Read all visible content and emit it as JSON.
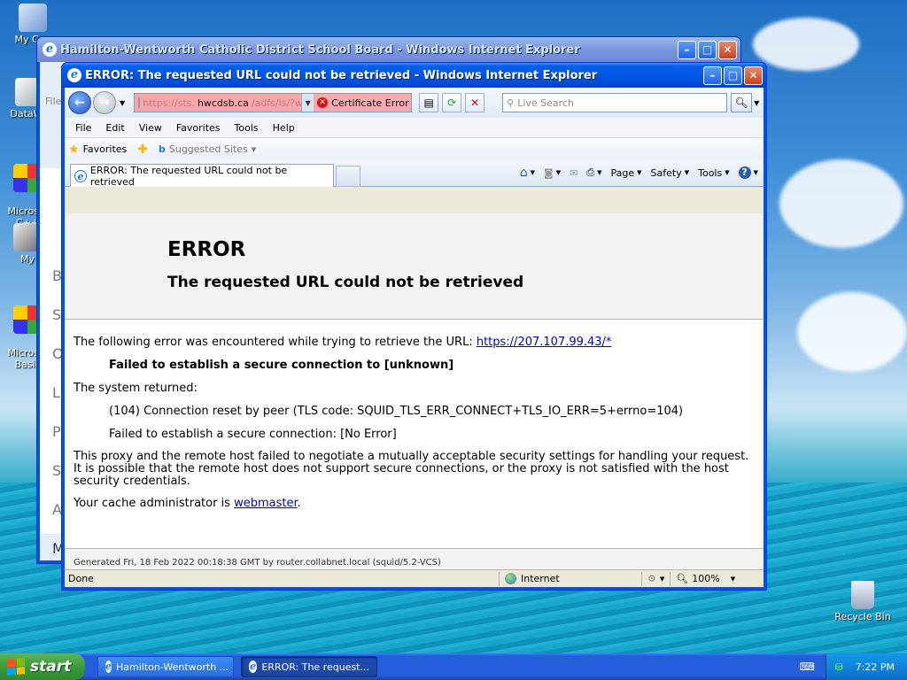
{
  "desktop": {
    "icons": [
      {
        "label": "My Con"
      },
      {
        "label": "DataWa"
      },
      {
        "label": "Microsol\nC++"
      },
      {
        "label": "My"
      },
      {
        "label": "Microsol\nBasic"
      },
      {
        "label": "Recycle Bin"
      }
    ]
  },
  "bg_window": {
    "title": "Hamilton-Wentworth Catholic District School Board - Windows Internet Explorer",
    "side_letters": [
      "B",
      "S",
      "O",
      "L",
      "P",
      "S",
      "A",
      "M"
    ],
    "file_menu": "File"
  },
  "window": {
    "title": "ERROR: The requested URL could not be retrieved - Windows Internet Explorer",
    "address": {
      "prefix": "https://sts.",
      "domain": "hwcdsb.ca",
      "suffix": "/adfs/ls/?wa"
    },
    "cert_error": "Certificate Error",
    "search_placeholder": "Live Search",
    "menu": [
      "File",
      "Edit",
      "View",
      "Favorites",
      "Tools",
      "Help"
    ],
    "favorites_label": "Favorites",
    "suggested_sites": "Suggested Sites",
    "tab_title": "ERROR: The requested URL could not be retrieved",
    "cmd": {
      "page": "Page",
      "safety": "Safety",
      "tools": "Tools"
    },
    "status": {
      "text": "Done",
      "zone": "Internet",
      "zoom": "100%"
    }
  },
  "page": {
    "h1": "ERROR",
    "h2": "The requested URL could not be retrieved",
    "intro": "The following error was encountered while trying to retrieve the URL: ",
    "url": "https://207.107.99.43/*",
    "failed": "Failed to establish a secure connection to [unknown]",
    "system_returned": "The system returned:",
    "reset": "(104) Connection reset by peer (TLS code: SQUID_TLS_ERR_CONNECT+TLS_IO_ERR=5+errno=104)",
    "failed2": "Failed to establish a secure connection: [No Error]",
    "explanation": "This proxy and the remote host failed to negotiate a mutually acceptable security settings for handling your request. It is possible that the remote host does not support secure connections, or the proxy is not satisfied with the host security credentials.",
    "cache_admin": "Your cache administrator is ",
    "webmaster": "webmaster",
    "period": ".",
    "generated": "Generated Fri, 18 Feb 2022 00:18:38 GMT by router.collabnet.local (squid/5.2-VCS)"
  },
  "taskbar": {
    "start": "start",
    "tasks": [
      "Hamilton-Wentworth ...",
      "ERROR: The request..."
    ],
    "clock": "7:22 PM"
  }
}
